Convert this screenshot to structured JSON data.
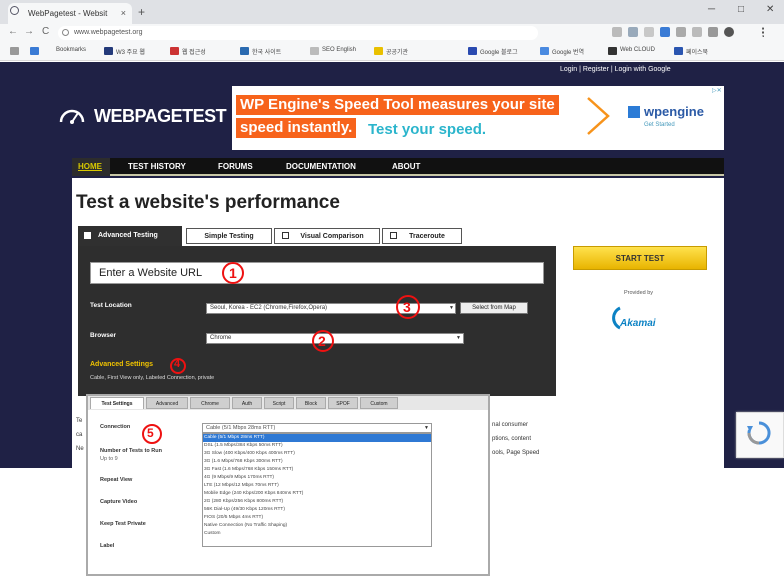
{
  "browser": {
    "tab_title": "WebPagetest - Websit",
    "tab_close": "×",
    "new_tab": "+",
    "url": "www.webpagetest.org",
    "window_controls": [
      "─",
      "□",
      "✕"
    ],
    "nav_icons": [
      "←",
      "→",
      "C"
    ],
    "bookmarks": [
      "Bookmarks",
      "W3 주요 웹",
      "웹 접근성",
      "한국 사이트",
      "SEO English",
      "공공기관",
      "Google 블로그",
      "Google 번역",
      "Web CLOUD",
      "페이스북"
    ]
  },
  "site": {
    "top_links": "Login  |  Register  |  Login with Google",
    "logo": "WEBPAGETEST",
    "ad": {
      "line1": "WP Engine's Speed Tool measures your site",
      "line2": "speed instantly.",
      "line3": "Test your speed.",
      "brand": "wpengine",
      "brand_sub": "Get Started",
      "close": "▷✕"
    },
    "nav": [
      "HOME",
      "TEST HISTORY",
      "FORUMS",
      "DOCUMENTATION",
      "ABOUT"
    ],
    "page_title": "Test a website's performance",
    "tabs": [
      "Advanced Testing",
      "Simple Testing",
      "Visual Comparison",
      "Traceroute"
    ],
    "url_placeholder": "Enter a Website URL",
    "test_location_label": "Test Location",
    "test_location_value": "Seoul, Korea - EC2 (Chrome,Firefox,Opera)",
    "select_map_label": "Select from Map",
    "browser_label": "Browser",
    "browser_value": "Chrome",
    "advanced_label": "Advanced Settings",
    "advanced_sub": "Cable, First View only, Labeled Connection, private",
    "start_button": "START TEST",
    "provided_by": "Provided by",
    "sponsor": "Akamai",
    "advanced_tabs": [
      "Test Settings",
      "Advanced",
      "Chrome",
      "Auth",
      "Script",
      "Block",
      "SPOF",
      "Custom"
    ],
    "form_labels": [
      "Connection",
      "Number of Tests to Run",
      "Repeat View",
      "Capture Video",
      "Keep Test Private",
      "Label"
    ],
    "runs_hint": "Up to 9",
    "connection_selected": "Cable (5/1 Mbps 28ms RTT)",
    "connection_options": [
      "Cable (5/1 Mbps 28ms RTT)",
      "DSL (1.5 Mbps/384 Kbps 50ms RTT)",
      "3G Slow (400 Kbps/400 Kbps 400ms RTT)",
      "3G (1.6 Mbps/768 Kbps 300ms RTT)",
      "3G Fast (1.6 Mbps/768 Kbps 150ms RTT)",
      "4G (9 Mbps/9 Mbps 170ms RTT)",
      "LTE (12 Mbps/12 Mbps 70ms RTT)",
      "Mobile Edge (240 Kbps/200 Kbps 840ms RTT)",
      "2G (280 Kbps/256 Kbps 800ms RTT)",
      "56K Dial-Up (49/30 Kbps 120ms RTT)",
      "FIOS (20/5 Mbps 4ms RTT)",
      "Native Connection (No Traffic Shaping)",
      "Custom"
    ],
    "right_text": [
      "nal consumer",
      "ptions, content",
      "ools, Page Speed"
    ],
    "left_text": [
      "Te",
      "ca",
      "Ne"
    ]
  },
  "annotations": [
    "1",
    "2",
    "3",
    "4",
    "5"
  ],
  "icons": {
    "logo_icon": "speedometer-icon",
    "captcha_icon": "recaptcha-icon"
  },
  "colors": {
    "site_bg": "#1f2145",
    "ad_orange": "#f7631b",
    "ad_teal": "#2bb5cc",
    "start_yellow": "#f5c800",
    "annotation_red": "#e11111",
    "highlight_blue": "#2f79d4"
  }
}
